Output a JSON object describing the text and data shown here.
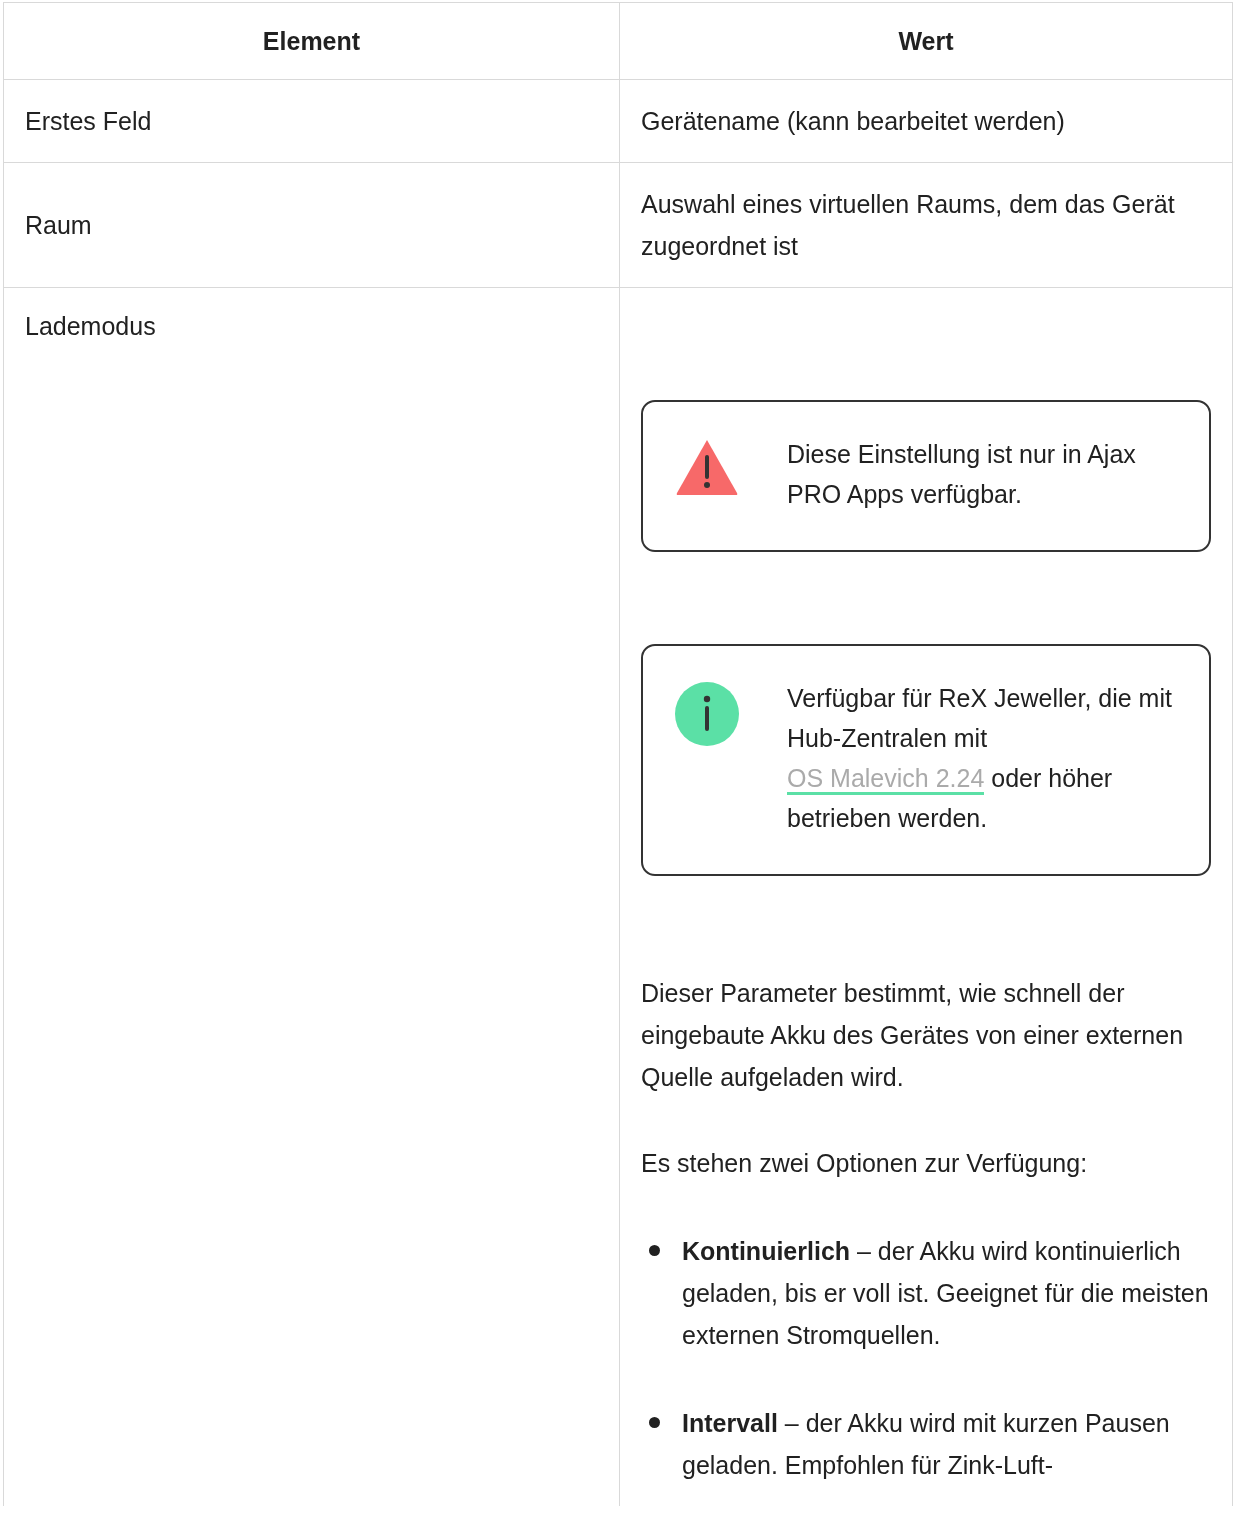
{
  "table": {
    "columns": [
      "Element",
      "Wert"
    ],
    "rows": [
      {
        "element": "Erstes Feld",
        "content": [
          {
            "kind": "paragraph",
            "text": "Gerätename (kann bearbeitet werden)"
          }
        ]
      },
      {
        "element": "Raum",
        "content": [
          {
            "kind": "paragraph",
            "text": "Auswahl eines virtuellen Raums, dem das Gerät zugeordnet ist"
          }
        ]
      },
      {
        "element": "Lademodus",
        "content": [
          {
            "kind": "warning",
            "text": "Diese Einstellung ist nur in Ajax PRO Apps verfügbar."
          },
          {
            "kind": "info",
            "text": "Verfügbar für ReX Jeweller, die mit Hub-Zentralen mit",
            "link": "OS Malevich 2.24",
            "after": "oder höher betrieben werden."
          },
          {
            "kind": "paragraph",
            "text": "Dieser Parameter bestimmt, wie schnell der eingebaute Akku des Gerätes von einer externen Quelle aufgeladen wird."
          },
          {
            "kind": "paragraph",
            "text": "Es stehen zwei Optionen zur Verfügung:"
          },
          {
            "kind": "bullets",
            "items": [
              "**Kontinuierlich** – der Akku wird kontinuierlich geladen, bis er voll ist. Geeignet für die meisten externen Stromquellen.",
              "**Intervall** – der Akku wird mit kurzen Pausen geladen. Empfohlen für Zink-Luft-"
            ]
          }
        ]
      }
    ]
  }
}
